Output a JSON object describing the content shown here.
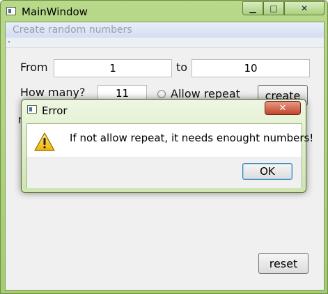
{
  "window": {
    "title": "MainWindow",
    "minimize_glyph": "▁",
    "maximize_glyph": "□",
    "close_glyph": "✕"
  },
  "menu": {
    "title": "Create random numbers"
  },
  "form": {
    "from_label": "From",
    "from_value": "1",
    "to_label": "to",
    "to_value": "10",
    "how_many_label": "How many?",
    "how_many_value": "11",
    "allow_repeat_label": "Allow repeat",
    "allow_repeat_checked": false,
    "create_label": "create",
    "reset_label": "reset",
    "partial_label": "r"
  },
  "dialog": {
    "title": "Error",
    "close_glyph": "✕",
    "message": "If not allow repeat, it needs enought numbers!",
    "ok_label": "OK",
    "icon": "warning-icon"
  }
}
